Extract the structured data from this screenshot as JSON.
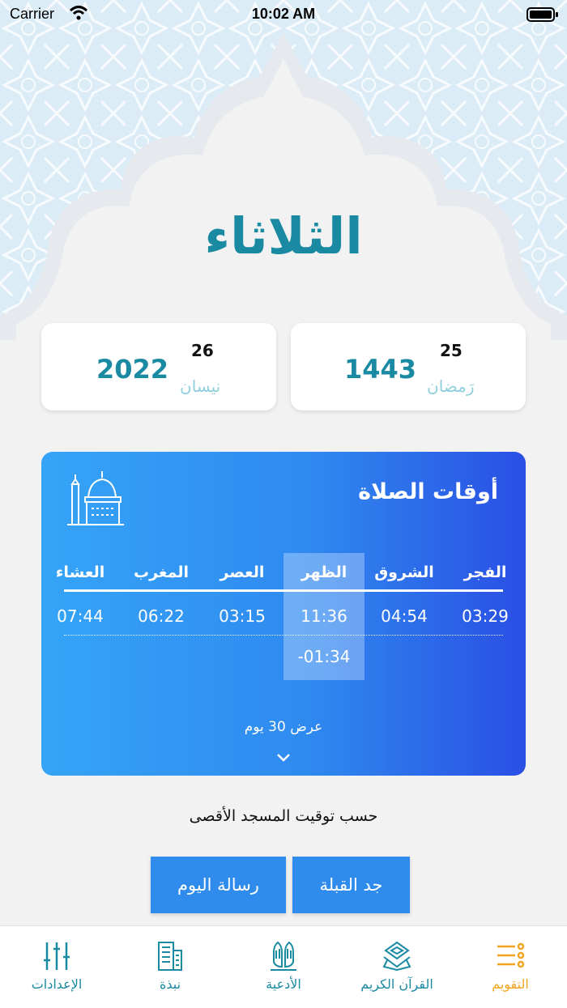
{
  "status_bar": {
    "carrier": "Carrier",
    "time": "10:02 AM"
  },
  "day_name": "الثلاثاء",
  "hijri_date": {
    "day": "25",
    "month": "رَمضان",
    "year": "1443"
  },
  "gregorian_date": {
    "day": "26",
    "month": "نيسان",
    "year": "2022"
  },
  "prayer_times": {
    "title": "أوقات الصلاة",
    "columns": [
      {
        "name": "الفجر",
        "time": "03:29"
      },
      {
        "name": "الشروق",
        "time": "04:54"
      },
      {
        "name": "الظهر",
        "time": "11:36"
      },
      {
        "name": "العصر",
        "time": "03:15"
      },
      {
        "name": "المغرب",
        "time": "06:22"
      },
      {
        "name": "العشاء",
        "time": "07:44"
      }
    ],
    "next_prayer_remaining": "-01:34",
    "show_more": "عرض 30 يوم"
  },
  "source_note": "حسب توقيت المسجد الأقصى",
  "buttons": {
    "qibla": "جد القبلة",
    "daily_message": "رسالة اليوم"
  },
  "tabs": [
    {
      "label": "التقويم",
      "icon": "calendar-list-icon"
    },
    {
      "label": "القرآن الكريم",
      "icon": "quran-icon"
    },
    {
      "label": "الأدعية",
      "icon": "praying-hands-icon"
    },
    {
      "label": "نبذة",
      "icon": "building-icon"
    },
    {
      "label": "الإعدادات",
      "icon": "sliders-icon"
    }
  ],
  "colors": {
    "accent": "#1a8aa3",
    "active_tab": "#f2a31f",
    "button": "#2f8cec",
    "gradient_start": "#35a4f7",
    "gradient_end": "#2a4fe4"
  }
}
